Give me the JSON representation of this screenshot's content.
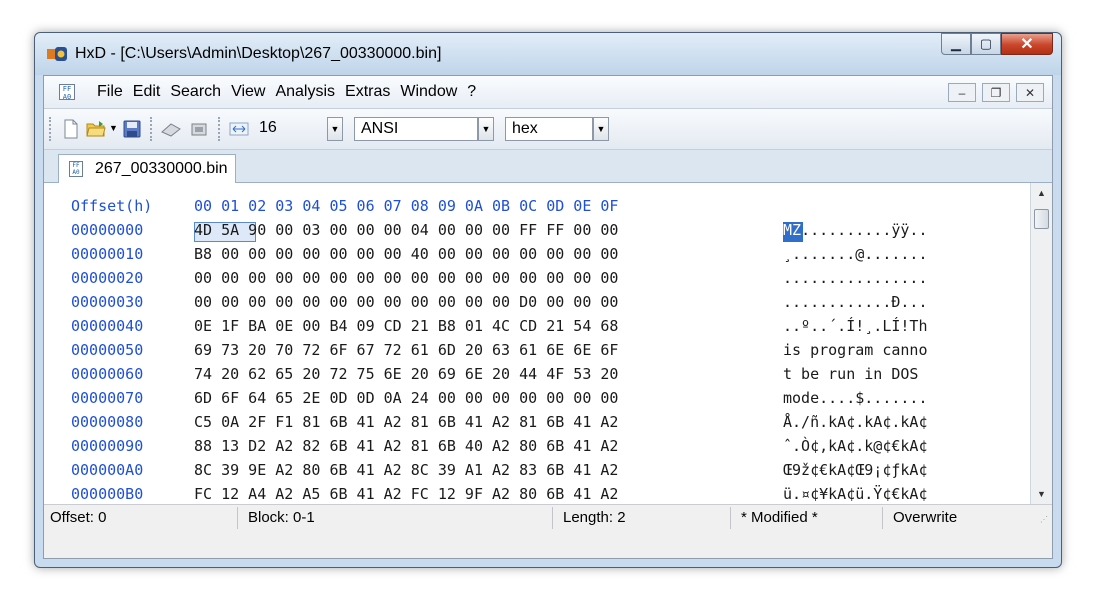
{
  "window": {
    "title": "HxD - [C:\\Users\\Admin\\Desktop\\267_00330000.bin]"
  },
  "menu": {
    "items": [
      "File",
      "Edit",
      "Search",
      "View",
      "Analysis",
      "Extras",
      "Window",
      "?"
    ]
  },
  "toolbar": {
    "bytes_per_row": "16",
    "charset": "ANSI",
    "offset_base": "hex"
  },
  "tab": {
    "label": "267_00330000.bin"
  },
  "editor": {
    "offset_header": "Offset(h)",
    "column_header": "00 01 02 03 04 05 06 07 08 09 0A 0B 0C 0D 0E 0F",
    "rows": [
      {
        "offset": "00000000",
        "hex": "4D 5A 90 00 03 00 00 00 04 00 00 00 FF FF 00 00",
        "ascii": "MZ..........ÿÿ.."
      },
      {
        "offset": "00000010",
        "hex": "B8 00 00 00 00 00 00 00 40 00 00 00 00 00 00 00",
        "ascii": "¸.......@......."
      },
      {
        "offset": "00000020",
        "hex": "00 00 00 00 00 00 00 00 00 00 00 00 00 00 00 00",
        "ascii": "................"
      },
      {
        "offset": "00000030",
        "hex": "00 00 00 00 00 00 00 00 00 00 00 00 D0 00 00 00",
        "ascii": "............Ð..."
      },
      {
        "offset": "00000040",
        "hex": "0E 1F BA 0E 00 B4 09 CD 21 B8 01 4C CD 21 54 68",
        "ascii": "..º..´.Í!¸.LÍ!Th"
      },
      {
        "offset": "00000050",
        "hex": "69 73 20 70 72 6F 67 72 61 6D 20 63 61 6E 6E 6F",
        "ascii": "is program canno"
      },
      {
        "offset": "00000060",
        "hex": "74 20 62 65 20 72 75 6E 20 69 6E 20 44 4F 53 20",
        "ascii": "t be run in DOS "
      },
      {
        "offset": "00000070",
        "hex": "6D 6F 64 65 2E 0D 0D 0A 24 00 00 00 00 00 00 00",
        "ascii": "mode....$......."
      },
      {
        "offset": "00000080",
        "hex": "C5 0A 2F F1 81 6B 41 A2 81 6B 41 A2 81 6B 41 A2",
        "ascii": "Å./ñ.kA¢.kA¢.kA¢"
      },
      {
        "offset": "00000090",
        "hex": "88 13 D2 A2 82 6B 41 A2 81 6B 40 A2 80 6B 41 A2",
        "ascii": "ˆ.Ò¢‚kA¢.k@¢€kA¢"
      },
      {
        "offset": "000000A0",
        "hex": "8C 39 9E A2 80 6B 41 A2 8C 39 A1 A2 83 6B 41 A2",
        "ascii": "Œ9ž¢€kA¢Œ9¡¢ƒkA¢"
      },
      {
        "offset": "000000B0",
        "hex": "FC 12 A4 A2 A5 6B 41 A2 FC 12 9F A2 80 6B 41 A2",
        "ascii": "ü.¤¢¥kA¢ü.Ÿ¢€kA¢"
      }
    ]
  },
  "status": {
    "offset": "Offset: 0",
    "block": "Block: 0-1",
    "length": "Length: 2",
    "modified": "* Modified *",
    "mode": "Overwrite"
  },
  "colors": {
    "offset_text": "#1f4fd8",
    "selection": "#2f6ec9",
    "close_button": "#c9452b"
  }
}
